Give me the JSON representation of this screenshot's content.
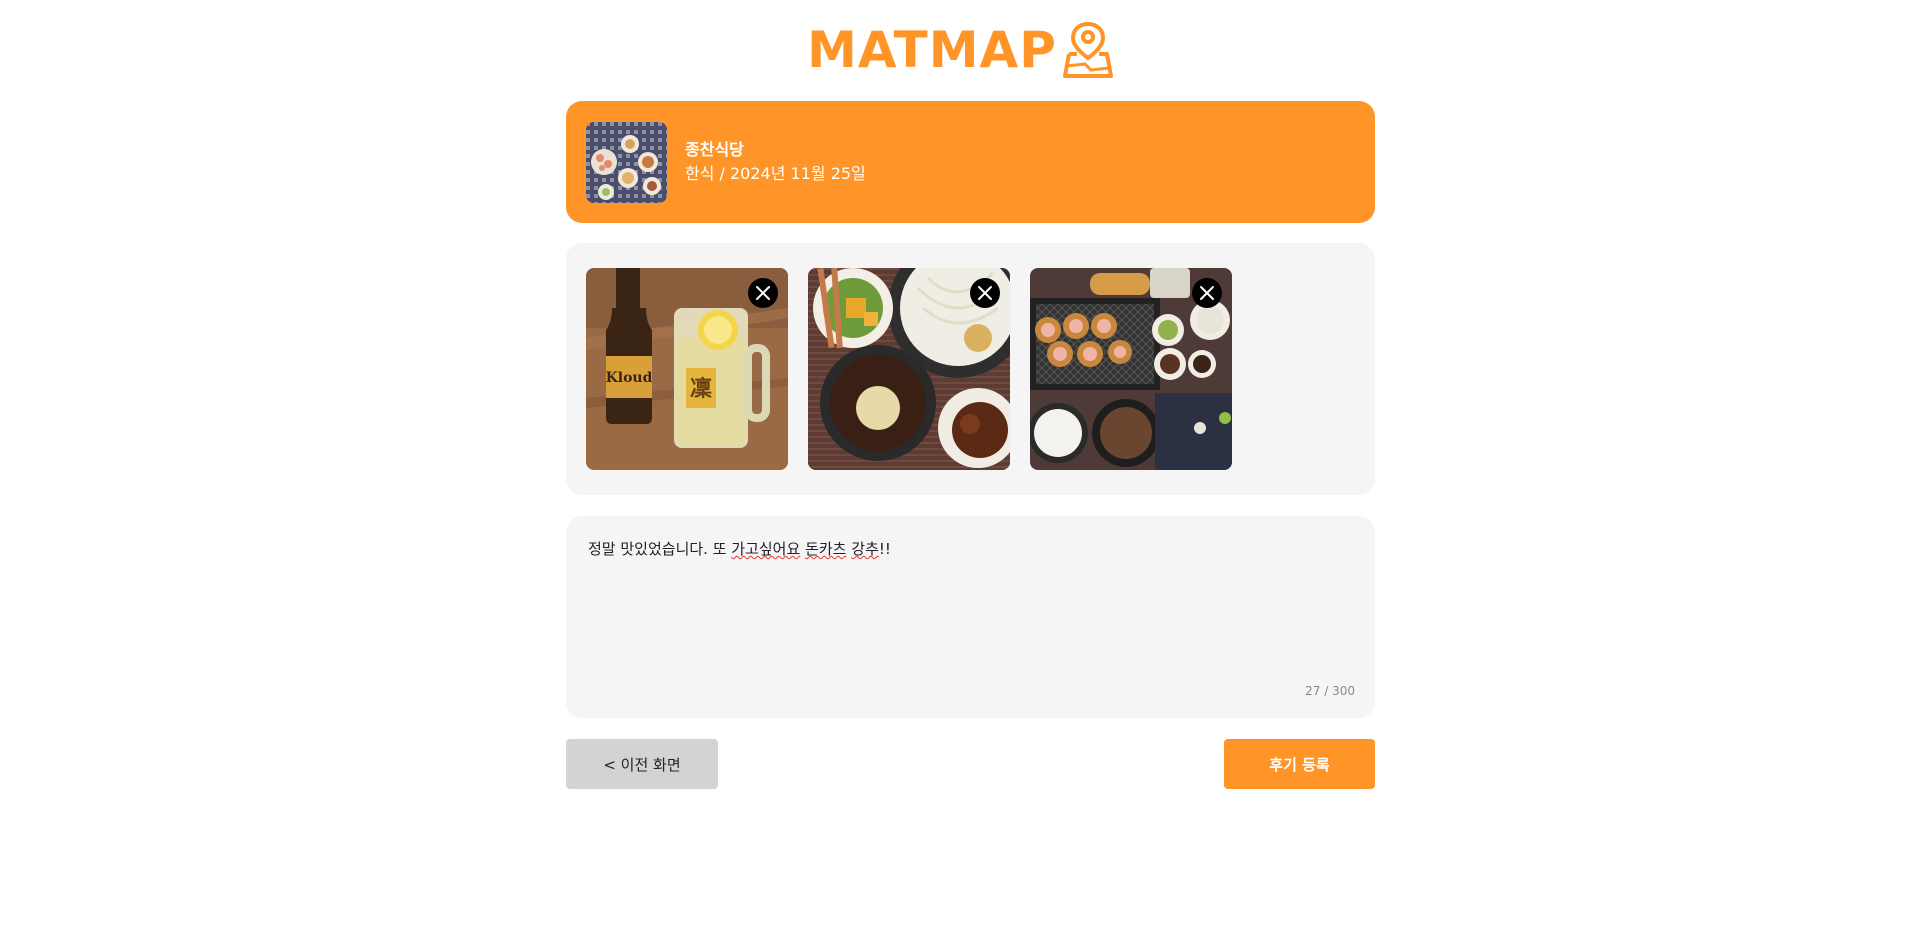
{
  "app": {
    "logo_text": "MATMAP",
    "accent_color": "#ff9528",
    "logo_icon": "map-pin-icon"
  },
  "restaurant": {
    "name": "종찬식당",
    "meta": "한식 / 2024년 11월 25일",
    "thumbnail_icon": "food-thumbnail"
  },
  "gallery": {
    "photos": [
      {
        "alt": "beer and highball photo",
        "remove_icon": "close-icon"
      },
      {
        "alt": "side dishes and sauce photo",
        "remove_icon": "close-icon"
      },
      {
        "alt": "tonkatsu set photo",
        "remove_icon": "close-icon"
      }
    ]
  },
  "review": {
    "text_part1": "정말 맛있었습니다. 또 ",
    "text_part2": "가고싶어요",
    "text_part3": " ",
    "text_part4": "돈카츠",
    "text_part5": " ",
    "text_part6": "강추",
    "text_part7": "!!",
    "char_count": "27 / 300"
  },
  "actions": {
    "back_label": "< 이전 화면",
    "submit_label": "후기 등록"
  }
}
